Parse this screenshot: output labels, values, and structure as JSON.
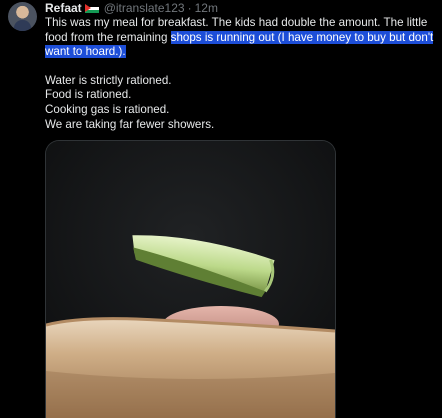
{
  "tweet": {
    "author_name": "Refaat",
    "handle": "@itranslate123",
    "separator": "·",
    "time": "12m",
    "text_part1": "This was my meal for breakfast. The kids had double the amount. The little food from the remaining ",
    "text_highlighted": "shops is running out (I have money to buy but don't want to hoard.).",
    "lines": [
      "Water is strictly rationed.",
      "Food is rationed.",
      "Cooking gas is rationed.",
      "We are taking far fewer showers."
    ]
  },
  "icons": {
    "avatar": "profile-photo",
    "flag": "palestinian-flag-icon"
  },
  "colors": {
    "background": "#000000",
    "text": "#e7e9ea",
    "muted": "#71767b",
    "selection": "#1d4ed8"
  }
}
